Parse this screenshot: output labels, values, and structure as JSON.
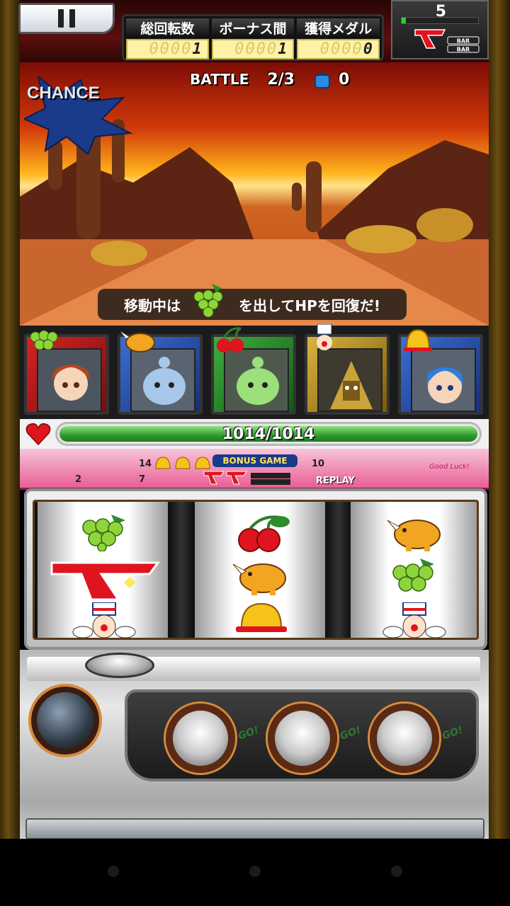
{
  "hud": {
    "counters": [
      {
        "label": "総回転数",
        "value_dim": "0000",
        "value_lit": "1"
      },
      {
        "label": "ボーナス間",
        "value_dim": "0000",
        "value_lit": "1"
      },
      {
        "label": "獲得メダル",
        "value_dim": "0000",
        "value_lit": "0"
      }
    ],
    "credits": "5",
    "credit_meter_fraction": 0.06
  },
  "scene": {
    "chance_text": "CHANCE",
    "battle_label": "BATTLE",
    "battle_progress": "2/3",
    "item_count": "0",
    "message_before": "移動中は",
    "message_after": "を出してHPを回復だ!"
  },
  "cards": [
    {
      "color": "red",
      "symbol": "grape-icon",
      "character": "girl-fox"
    },
    {
      "color": "blue",
      "symbol": "rhino-icon",
      "character": "ghost-blue"
    },
    {
      "color": "green",
      "symbol": "cherry-icon",
      "character": "ghost-green"
    },
    {
      "color": "gold",
      "symbol": "clown-icon",
      "character": "sphinx"
    },
    {
      "color": "blue",
      "symbol": "bell-icon",
      "character": "girl-bunny"
    }
  ],
  "hp": {
    "text": "1014/1014",
    "fraction": 1.0
  },
  "payout": {
    "left_num_top": "14",
    "left_num_bottom_a": "2",
    "left_num_bottom_b": "7",
    "bonus_title": "BONUS GAME",
    "right_num": "10",
    "replay": "REPLAY",
    "goodluck": "Good Luck!"
  },
  "reels": [
    [
      "grape-icon",
      "seven-icon",
      "clown-icon"
    ],
    [
      "cherry-icon",
      "rhino-icon",
      "bell-icon"
    ],
    [
      "rhino-icon",
      "grape-icon",
      "clown-icon"
    ]
  ],
  "cabinet": {
    "go_label": "GO!"
  },
  "colors": {
    "hp_green": "#2f9b2f",
    "seven_red": "#e0141e",
    "counter_bg": "#fdf2a6"
  }
}
